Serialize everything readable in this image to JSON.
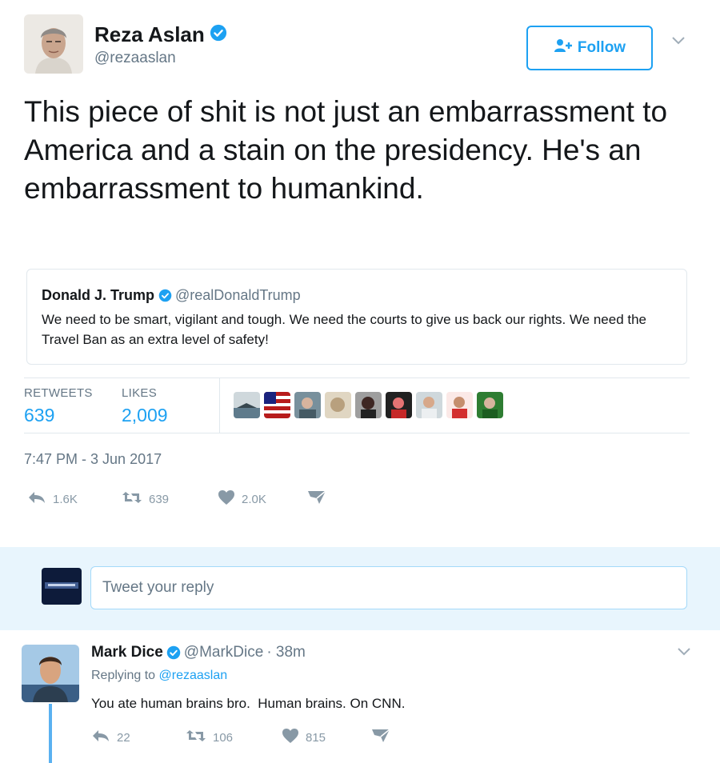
{
  "tweet": {
    "author": {
      "name": "Reza Aslan",
      "handle": "@rezaaslan",
      "verified": true
    },
    "follow_label": "Follow",
    "text": "This piece of shit is not just an embarrassment to America and a stain on the presidency. He's an embarrassment to humankind.",
    "quoted": {
      "name": "Donald J. Trump",
      "handle": "@realDonaldTrump",
      "text": "We need to be smart, vigilant and tough. We need the courts to give us back our rights. We need the Travel Ban as an extra level of safety!"
    },
    "stats": {
      "retweets_label": "RETWEETS",
      "retweets_value": "639",
      "likes_label": "LIKES",
      "likes_value": "2,009"
    },
    "timestamp": "7:47 PM - 3 Jun 2017",
    "actions": {
      "reply_count": "1.6K",
      "retweet_count": "639",
      "like_count": "2.0K"
    }
  },
  "reply_box": {
    "placeholder": "Tweet your reply"
  },
  "reply": {
    "name": "Mark Dice",
    "handle": "@MarkDice",
    "time": "· 38m",
    "replying_prefix": "Replying to",
    "replying_to": "@rezaaslan",
    "text": "You ate human brains bro.  Human brains. On CNN.",
    "actions": {
      "reply_count": "22",
      "retweet_count": "106",
      "like_count": "815"
    }
  },
  "colors": {
    "accent": "#1da1f2",
    "muted": "#657786",
    "reply_bg": "#e8f5fd",
    "thread_line": "#5ab1f1"
  }
}
